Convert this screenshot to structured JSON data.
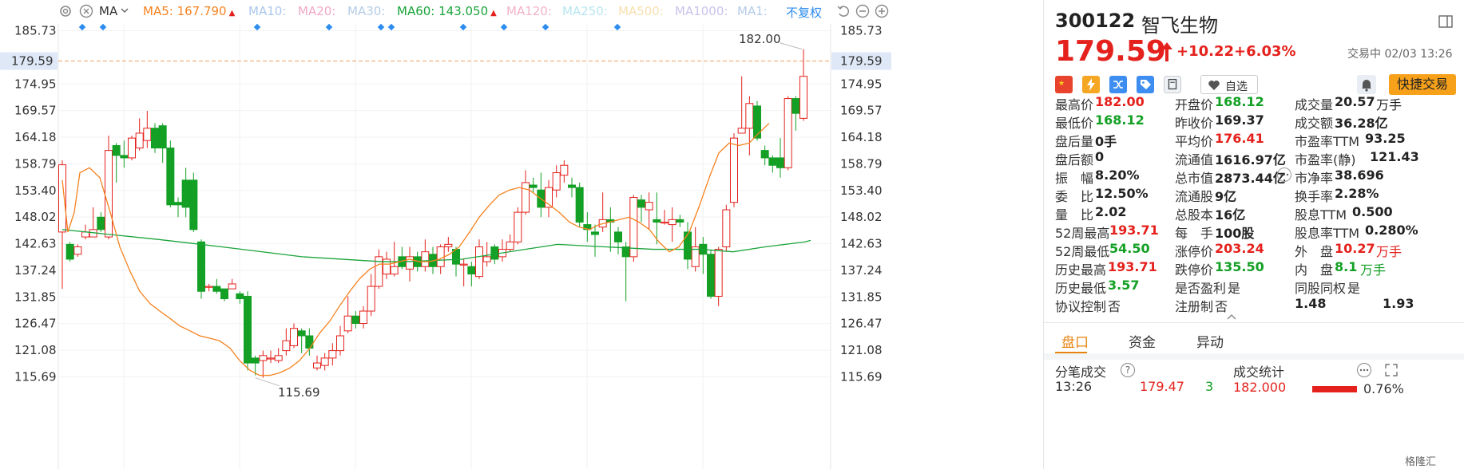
{
  "toolbar": {
    "ma_label": "MA",
    "items": [
      {
        "label": "MA5: 167.790",
        "color": "#f5821f",
        "arrow": "up"
      },
      {
        "label": "MA10:",
        "color": "#a9c7ec"
      },
      {
        "label": "MA20:",
        "color": "#f0a8c8"
      },
      {
        "label": "MA30:",
        "color": "#b5cce8"
      },
      {
        "label": "MA60: 143.050",
        "color": "#19a43a",
        "arrow": "up"
      },
      {
        "label": "MA120:",
        "color": "#f3b2c6"
      },
      {
        "label": "MA250:",
        "color": "#b7e6ee"
      },
      {
        "label": "MA500:",
        "color": "#f7e0b0"
      },
      {
        "label": "MA1000:",
        "color": "#c9c3ec"
      },
      {
        "label": "MA1:",
        "color": "#b5cce8"
      }
    ],
    "fq_label": "不复权"
  },
  "chart_data": {
    "type": "candlestick",
    "ylim": [
      113.5,
      187.5
    ],
    "y_ticks": [
      "185.73",
      "179.59",
      "174.95",
      "169.57",
      "164.18",
      "158.79",
      "153.40",
      "148.02",
      "142.63",
      "137.24",
      "131.85",
      "126.47",
      "121.08",
      "115.69"
    ],
    "current_price_label": "179.59",
    "high_annotation": "182.00",
    "low_annotation": "115.69",
    "candles": [
      [
        145.0,
        158.6,
        159.5,
        133.5
      ],
      [
        142.5,
        139.5,
        143.0,
        139.0
      ],
      [
        140.5,
        142.0,
        142.5,
        140.0
      ],
      [
        144.0,
        145.0,
        146.5,
        143.5
      ],
      [
        144.0,
        145.5,
        150.0,
        144.0
      ],
      [
        148.0,
        145.5,
        149.0,
        145.0
      ],
      [
        144.0,
        161.5,
        164.5,
        143.5
      ],
      [
        162.5,
        160.5,
        163.0,
        155.0
      ],
      [
        160.5,
        160.0,
        163.5,
        158.0
      ],
      [
        160.0,
        164.0,
        164.5,
        159.5
      ],
      [
        162.0,
        165.0,
        168.0,
        161.5
      ],
      [
        163.5,
        166.0,
        169.5,
        162.0
      ],
      [
        166.0,
        162.0,
        167.0,
        161.0
      ],
      [
        166.5,
        162.0,
        167.0,
        159.0
      ],
      [
        162.0,
        150.5,
        163.5,
        150.0
      ],
      [
        151.0,
        150.5,
        152.0,
        148.0
      ],
      [
        155.5,
        150.0,
        158.0,
        148.0
      ],
      [
        155.5,
        145.5,
        157.0,
        145.0
      ],
      [
        143.0,
        133.0,
        143.5,
        131.5
      ],
      [
        134.0,
        134.0,
        134.5,
        133.0
      ],
      [
        134.0,
        133.0,
        135.5,
        132.5
      ],
      [
        133.5,
        131.5,
        133.5,
        131.0
      ],
      [
        133.5,
        134.5,
        135.5,
        134.0
      ],
      [
        132.5,
        131.5,
        133.0,
        130.5
      ],
      [
        132.0,
        118.5,
        133.0,
        117.0
      ],
      [
        119.5,
        118.5,
        120.0,
        116.0
      ],
      [
        119.0,
        120.0,
        121.0,
        115.5
      ],
      [
        119.5,
        119.5,
        121.0,
        118.5
      ],
      [
        119.0,
        120.0,
        121.5,
        118.5
      ],
      [
        121.0,
        123.0,
        125.5,
        120.0
      ],
      [
        122.0,
        125.5,
        126.5,
        121.5
      ],
      [
        125.0,
        124.0,
        125.5,
        120.5
      ],
      [
        124.0,
        121.5,
        125.5,
        120.0
      ],
      [
        117.5,
        118.5,
        120.0,
        117.0
      ],
      [
        118.0,
        119.5,
        120.5,
        117.0
      ],
      [
        119.5,
        121.0,
        122.5,
        118.0
      ],
      [
        121.0,
        124.0,
        126.0,
        120.0
      ],
      [
        125.0,
        128.0,
        132.0,
        124.5
      ],
      [
        128.0,
        126.5,
        129.0,
        125.5
      ],
      [
        126.5,
        129.0,
        130.0,
        125.5
      ],
      [
        129.0,
        134.0,
        136.5,
        128.0
      ],
      [
        134.0,
        140.0,
        141.5,
        133.5
      ],
      [
        136.5,
        139.5,
        141.0,
        135.5
      ],
      [
        136.5,
        138.0,
        143.0,
        136.0
      ],
      [
        140.0,
        138.0,
        142.0,
        137.5
      ],
      [
        137.5,
        140.0,
        142.0,
        135.0
      ],
      [
        140.0,
        138.0,
        141.0,
        137.0
      ],
      [
        138.0,
        141.0,
        143.5,
        137.0
      ],
      [
        140.5,
        138.0,
        142.0,
        136.5
      ],
      [
        138.0,
        142.0,
        142.5,
        136.5
      ],
      [
        142.0,
        142.5,
        144.0,
        141.0
      ],
      [
        141.5,
        138.5,
        142.0,
        136.0
      ],
      [
        138.5,
        138.5,
        139.5,
        134.0
      ],
      [
        138.0,
        136.5,
        139.0,
        134.0
      ],
      [
        136.0,
        142.0,
        143.5,
        135.5
      ],
      [
        139.0,
        140.0,
        143.0,
        138.0
      ],
      [
        142.0,
        139.5,
        142.5,
        138.5
      ],
      [
        140.0,
        141.5,
        143.5,
        139.0
      ],
      [
        141.5,
        143.0,
        144.5,
        141.0
      ],
      [
        143.0,
        149.0,
        150.0,
        142.5
      ],
      [
        149.0,
        155.0,
        157.5,
        148.5
      ],
      [
        154.5,
        154.0,
        156.0,
        153.0
      ],
      [
        153.5,
        150.0,
        157.0,
        148.0
      ],
      [
        150.0,
        154.0,
        155.5,
        148.0
      ],
      [
        153.5,
        157.0,
        158.5,
        152.0
      ],
      [
        156.5,
        158.5,
        159.5,
        155.0
      ],
      [
        154.5,
        154.0,
        156.0,
        152.0
      ],
      [
        154.0,
        147.0,
        155.0,
        146.0
      ],
      [
        146.5,
        145.5,
        149.0,
        143.0
      ],
      [
        145.0,
        144.5,
        146.5,
        140.0
      ],
      [
        146.0,
        147.5,
        153.0,
        145.0
      ],
      [
        147.5,
        147.0,
        150.0,
        141.0
      ],
      [
        145.0,
        143.0,
        146.0,
        140.5
      ],
      [
        142.0,
        140.0,
        143.0,
        131.0
      ],
      [
        140.0,
        152.0,
        152.5,
        139.0
      ],
      [
        151.5,
        150.0,
        152.5,
        147.0
      ],
      [
        149.5,
        151.0,
        153.0,
        145.5
      ],
      [
        147.5,
        147.0,
        153.0,
        142.5
      ],
      [
        147.0,
        147.0,
        149.5,
        146.5
      ],
      [
        146.5,
        147.5,
        150.0,
        143.0
      ],
      [
        147.5,
        147.0,
        148.5,
        146.0
      ],
      [
        145.0,
        139.5,
        147.0,
        137.5
      ],
      [
        138.0,
        142.0,
        146.0,
        137.0
      ],
      [
        142.5,
        140.5,
        144.0,
        136.5
      ],
      [
        140.5,
        132.0,
        141.5,
        131.5
      ],
      [
        132.0,
        141.5,
        142.0,
        130.0
      ],
      [
        142.0,
        149.5,
        150.5,
        141.0
      ],
      [
        151.0,
        164.0,
        165.0,
        150.0
      ],
      [
        165.0,
        166.0,
        176.5,
        165.5
      ],
      [
        166.0,
        171.0,
        172.5,
        160.5
      ],
      [
        170.5,
        164.0,
        171.5,
        163.5
      ],
      [
        161.5,
        160.0,
        162.5,
        158.5
      ],
      [
        160.0,
        158.5,
        160.5,
        157.0
      ],
      [
        160.0,
        158.0,
        164.0,
        156.0
      ],
      [
        158.0,
        172.0,
        172.5,
        157.5
      ],
      [
        172.0,
        169.0,
        172.5,
        165.5
      ],
      [
        168.0,
        176.5,
        182.0,
        167.5
      ]
    ],
    "ma5": [
      [
        0,
        155.5
      ],
      [
        7,
        145
      ],
      [
        15,
        149
      ],
      [
        22,
        157
      ],
      [
        34,
        158
      ],
      [
        47,
        156
      ],
      [
        60,
        149
      ],
      [
        72,
        142
      ],
      [
        85,
        137
      ],
      [
        97,
        133
      ],
      [
        110,
        130.5
      ],
      [
        122,
        129
      ],
      [
        135,
        127.5
      ],
      [
        147,
        126
      ],
      [
        160,
        125
      ],
      [
        172,
        124
      ],
      [
        185,
        123.5
      ],
      [
        197,
        123
      ],
      [
        210,
        121.5
      ],
      [
        222,
        119
      ],
      [
        235,
        117
      ],
      [
        247,
        116
      ],
      [
        260,
        116
      ],
      [
        272,
        116.5
      ],
      [
        285,
        117.5
      ],
      [
        297,
        119
      ],
      [
        310,
        121.5
      ],
      [
        322,
        124.5
      ],
      [
        335,
        127
      ],
      [
        347,
        130
      ],
      [
        360,
        133
      ],
      [
        372,
        135.5
      ],
      [
        385,
        137.5
      ],
      [
        397,
        138.5
      ],
      [
        410,
        138.5
      ],
      [
        422,
        139
      ],
      [
        435,
        139.5
      ],
      [
        447,
        139
      ],
      [
        460,
        139
      ],
      [
        472,
        139.5
      ],
      [
        485,
        140.5
      ],
      [
        497,
        142
      ],
      [
        510,
        145
      ],
      [
        522,
        148
      ],
      [
        535,
        150.5
      ],
      [
        547,
        152.5
      ],
      [
        560,
        153.5
      ],
      [
        572,
        154
      ],
      [
        585,
        153.5
      ],
      [
        597,
        152
      ],
      [
        610,
        150.5
      ],
      [
        622,
        149
      ],
      [
        635,
        147
      ],
      [
        647,
        146
      ],
      [
        660,
        145.5
      ],
      [
        672,
        146.5
      ],
      [
        685,
        147
      ],
      [
        697,
        147.5
      ],
      [
        710,
        148
      ],
      [
        722,
        147
      ],
      [
        735,
        145.5
      ],
      [
        747,
        143
      ],
      [
        760,
        141
      ],
      [
        772,
        142
      ],
      [
        785,
        145
      ],
      [
        797,
        150
      ],
      [
        810,
        156
      ],
      [
        822,
        161
      ],
      [
        835,
        163
      ],
      [
        847,
        162.5
      ],
      [
        860,
        163
      ],
      [
        872,
        165
      ],
      [
        885,
        167
      ]
    ],
    "ma60": [
      [
        0,
        145.5
      ],
      [
        60,
        144.5
      ],
      [
        120,
        143.5
      ],
      [
        200,
        142
      ],
      [
        300,
        140
      ],
      [
        400,
        139
      ],
      [
        430,
        139
      ],
      [
        500,
        139.5
      ],
      [
        560,
        141
      ],
      [
        620,
        142.5
      ],
      [
        680,
        142
      ],
      [
        740,
        141.5
      ],
      [
        800,
        141.5
      ],
      [
        840,
        141
      ],
      [
        880,
        142
      ],
      [
        930,
        143
      ],
      [
        937,
        143.3
      ]
    ]
  },
  "panel": {
    "code": "300122",
    "name": "智飞生物",
    "price": "179.59",
    "change": "+10.22",
    "change_pct": "+6.03%",
    "time_label": "交易中 02/03 13:26",
    "watch_label": "自选",
    "quick_trade_label": "快捷交易",
    "quote_rows": [
      [
        {
          "label": "最高价",
          "value": "182.00",
          "c": "red"
        },
        {
          "label": "开盘价",
          "value": "168.12",
          "c": "green"
        },
        {
          "label": "成交量",
          "value": "20.57",
          "unit": "万手",
          "c": "blk"
        }
      ],
      [
        {
          "label": "最低价",
          "value": "168.12",
          "c": "green"
        },
        {
          "label": "昨收价",
          "value": "169.37",
          "c": "blk"
        },
        {
          "label": "成交额",
          "value": "36.28亿",
          "c": "blk"
        }
      ],
      [
        {
          "label": "盘后量",
          "value": "0手",
          "c": "blk"
        },
        {
          "label": "平均价",
          "value": "176.41",
          "c": "red"
        },
        {
          "label": "市盈率TTM",
          "value": "93.25",
          "c": "blk"
        }
      ],
      [
        {
          "label": "盘后额",
          "value": "0",
          "c": "blk"
        },
        {
          "label": "流通值",
          "value": "1616.97亿",
          "c": "blk"
        },
        {
          "label": "市盈率(静)",
          "value": "121.43",
          "c": "blk"
        }
      ],
      [
        {
          "label": "振　幅",
          "value": "8.20%",
          "c": "blk"
        },
        {
          "label": "总市值",
          "value": "2873.44亿",
          "c": "blk"
        },
        {
          "label": "市净率",
          "value": "38.696",
          "c": "blk"
        }
      ],
      [
        {
          "label": "委　比",
          "value": "12.50%",
          "c": "blk"
        },
        {
          "label": "流通股",
          "value": "9亿",
          "c": "blk"
        },
        {
          "label": "换手率",
          "value": "2.28%",
          "c": "blk"
        }
      ],
      [
        {
          "label": "量　比",
          "value": "2.02",
          "c": "blk"
        },
        {
          "label": "总股本",
          "value": "16亿",
          "c": "blk"
        },
        {
          "label": "股息TTM",
          "value": "0.500",
          "c": "blk"
        }
      ],
      [
        {
          "label": "52周最高",
          "value": "193.71",
          "c": "red"
        },
        {
          "label": "每　手",
          "value": "100股",
          "c": "blk"
        },
        {
          "label": "股息率TTM",
          "value": "0.280%",
          "c": "blk"
        }
      ],
      [
        {
          "label": "52周最低",
          "value": "54.50",
          "c": "green"
        },
        {
          "label": "涨停价",
          "value": "203.24",
          "c": "red"
        },
        {
          "label": "外　盘",
          "value": "10.27",
          "unit": "万手",
          "c": "red"
        }
      ],
      [
        {
          "label": "历史最高",
          "value": "193.71",
          "c": "red"
        },
        {
          "label": "跌停价",
          "value": "135.50",
          "c": "green"
        },
        {
          "label": "内　盘",
          "value": "8.1",
          "unit": "万手",
          "c": "green"
        }
      ],
      [
        {
          "label": "历史最低",
          "value": "3.57",
          "c": "green"
        },
        {
          "label": "是否盈利",
          "value": "是",
          "c": "ql"
        },
        {
          "label": "同股同权",
          "value": "是",
          "c": "ql"
        }
      ],
      [
        {
          "label": "协议控制",
          "value": "否",
          "c": "ql"
        },
        {
          "label": "注册制",
          "value": "否",
          "c": "ql"
        },
        {
          "label": "1.48",
          "value": "1.93",
          "c": "blk"
        }
      ]
    ],
    "tabs": [
      "盘口",
      "资金",
      "异动"
    ],
    "sub_left": "分笔成交",
    "sub_right": "成交统计",
    "partial_left": [
      "13:26",
      "179.47",
      "3"
    ],
    "partial_right": "182.000",
    "partial_pct": "0.76%",
    "watermark": "格隆汇"
  },
  "colors": {
    "up": "#e4211c",
    "down": "#13a024",
    "ma5": "#f5821f",
    "ma60": "#19a43a",
    "axis_text": "#333333",
    "blue_marker": "#2d8cf0"
  }
}
